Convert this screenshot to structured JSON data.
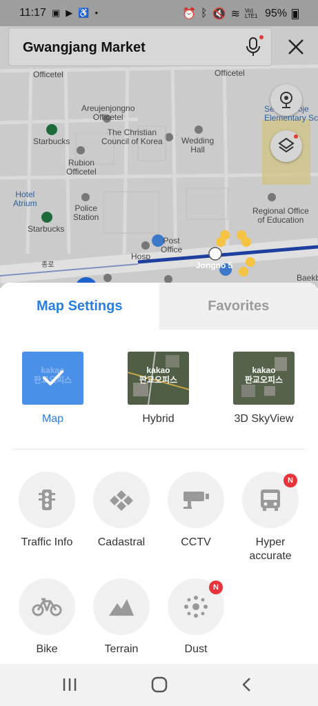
{
  "status": {
    "time": "11:17",
    "signal_text": "Vo) LTE1",
    "battery": "95%"
  },
  "search": {
    "query": "Gwangjang Market"
  },
  "map": {
    "labels": {
      "officetel_left": "Officetel",
      "officetel_right": "Officetel",
      "areujenjongno": "Areujenjongno\nOfficetel",
      "starbucks_top": "Starbucks",
      "christian_council": "The Christian\nCouncil of Korea",
      "wedding_hall": "Wedding\nHall",
      "seoul_hyoje": "Seoul Hyoje\nElementary Scho",
      "rubion": "Rubion\nOfficetel",
      "hotel_atrium": "Hotel\nAtrium",
      "police_station": "Police\nStation",
      "regional_office": "Regional Office\nof Education",
      "starbucks_bottom": "Starbucks",
      "post_office": "Post\nOffice",
      "hospital": "Hosp",
      "jongno5": "Jongno 5",
      "jongno_road": "종로",
      "baekbo": "Baekb"
    },
    "route_markers": [
      "1",
      "2",
      "3",
      "4",
      "5",
      "6"
    ],
    "hospital_marker": "4",
    "station_marker": "1"
  },
  "sheet": {
    "tabs": [
      {
        "label": "Map Settings",
        "active": true
      },
      {
        "label": "Favorites",
        "active": false
      }
    ],
    "map_types": [
      {
        "label": "Map",
        "selected": true,
        "watermark": "kakao\n판교오피스"
      },
      {
        "label": "Hybrid",
        "selected": false,
        "watermark": "kakao\n판교오피스"
      },
      {
        "label": "3D SkyView",
        "selected": false,
        "watermark": "kakao\n판교오피스"
      }
    ],
    "layers": [
      {
        "label": "Traffic Info",
        "icon": "traffic-light-icon",
        "badge": ""
      },
      {
        "label": "Cadastral",
        "icon": "cadastral-icon",
        "badge": ""
      },
      {
        "label": "CCTV",
        "icon": "cctv-icon",
        "badge": ""
      },
      {
        "label": "Hyper\naccurate",
        "icon": "bus-icon",
        "badge": "N"
      },
      {
        "label": "Bike",
        "icon": "bike-icon",
        "badge": ""
      },
      {
        "label": "Terrain",
        "icon": "mountain-icon",
        "badge": ""
      },
      {
        "label": "Dust",
        "icon": "dust-icon",
        "badge": "N"
      }
    ]
  },
  "colors": {
    "accent": "#2a7de1",
    "badge": "#e8333a",
    "map_bg": "#c8c8c8",
    "route": "#1f3f9e"
  }
}
